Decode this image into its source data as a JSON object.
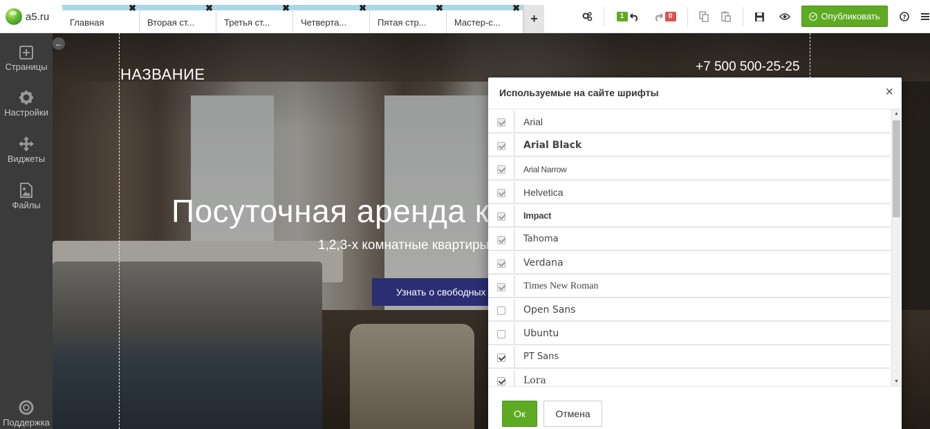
{
  "logo": {
    "text": "a5.ru"
  },
  "tabs": [
    {
      "label": "Главная"
    },
    {
      "label": "Вторая ст..."
    },
    {
      "label": "Третья ст..."
    },
    {
      "label": "Четверта..."
    },
    {
      "label": "Пятая стр..."
    },
    {
      "label": "Мастер-с..."
    }
  ],
  "tab_close": "✖",
  "add_tab": "+",
  "toolbar": {
    "undo_count": "1",
    "redo_count": "0",
    "publish_label": "Опубликовать",
    "colors": {
      "green": "#5eaa22",
      "red": "#d9534f"
    }
  },
  "sidebar": {
    "items": [
      {
        "label": "Страницы",
        "icon": "pages-icon"
      },
      {
        "label": "Настройки",
        "icon": "gear-icon"
      },
      {
        "label": "Виджеты",
        "icon": "move-icon"
      },
      {
        "label": "Файлы",
        "icon": "image-icon"
      },
      {
        "label": "Поддержка",
        "icon": "lifebuoy-icon"
      }
    ]
  },
  "site": {
    "name": "НАЗВАНИЕ",
    "phone": "+7 500 500-25-25",
    "hero_title": "Посуточная аренда к",
    "hero_subtitle": "1,2,3-х комнатные квартиры",
    "cta_label": "Узнать о свободных"
  },
  "modal": {
    "title": "Используемые на сайте шрифты",
    "close": "×",
    "fonts": [
      {
        "name": "Arial",
        "checked": true,
        "disabled": true
      },
      {
        "name": "Arial Black",
        "checked": true,
        "disabled": true
      },
      {
        "name": "Arial Narrow",
        "checked": true,
        "disabled": true
      },
      {
        "name": "Helvetica",
        "checked": true,
        "disabled": true
      },
      {
        "name": "Impact",
        "checked": true,
        "disabled": true
      },
      {
        "name": "Tahoma",
        "checked": true,
        "disabled": true
      },
      {
        "name": "Verdana",
        "checked": true,
        "disabled": true
      },
      {
        "name": "Times New Roman",
        "checked": true,
        "disabled": true
      },
      {
        "name": "Open Sans",
        "checked": false,
        "disabled": false
      },
      {
        "name": "Ubuntu",
        "checked": false,
        "disabled": false
      },
      {
        "name": "PT Sans",
        "checked": true,
        "disabled": false
      },
      {
        "name": "Lora",
        "checked": true,
        "disabled": false
      }
    ],
    "ok_label": "Ок",
    "cancel_label": "Отмена"
  }
}
